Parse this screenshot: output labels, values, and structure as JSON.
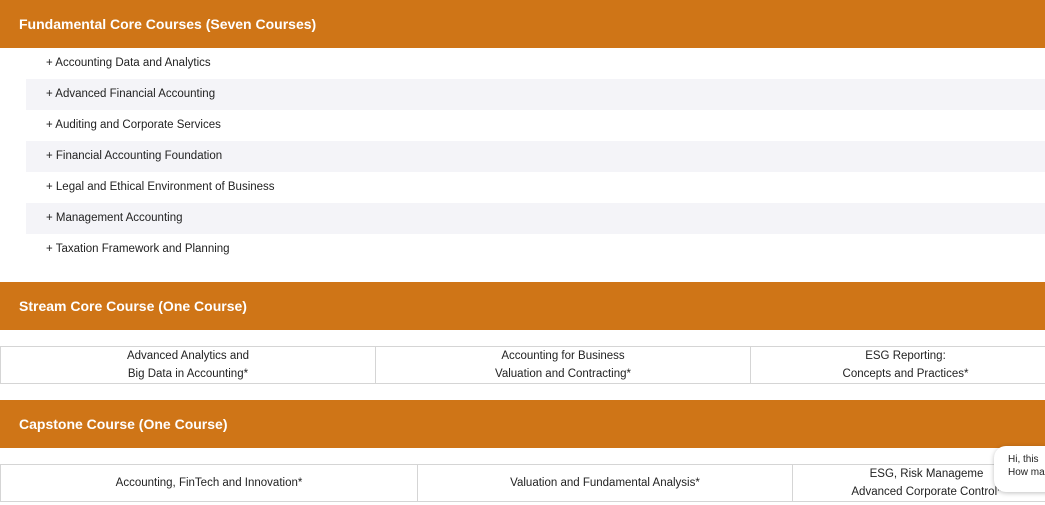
{
  "fundamental": {
    "title": "Fundamental Core Courses (Seven Courses)",
    "items": [
      "+ Accounting Data and Analytics",
      "+ Advanced Financial Accounting",
      "+ Auditing and Corporate Services",
      "+ Financial Accounting Foundation",
      "+ Legal and Ethical Environment of Business",
      "+ Management Accounting",
      "+ Taxation Framework and Planning"
    ]
  },
  "stream": {
    "title": "Stream Core Course (One Course)",
    "cells": [
      {
        "line1": "Advanced Analytics and",
        "line2": "Big Data in Accounting*"
      },
      {
        "line1": "Accounting for Business",
        "line2": "Valuation and Contracting*"
      },
      {
        "line1": "ESG Reporting:",
        "line2": "Concepts and Practices*"
      }
    ]
  },
  "capstone": {
    "title": "Capstone Course (One Course)",
    "cells": [
      {
        "line1": "Accounting, FinTech and Innovation*"
      },
      {
        "line1": "Valuation and Fundamental Analysis*"
      },
      {
        "line1": "ESG, Risk Manageme",
        "line2": "Advanced Corporate Control*"
      }
    ]
  },
  "chat": {
    "line1": "Hi, this",
    "line2": "How ma"
  },
  "colors": {
    "accent": "#cf7517",
    "stripe": "#f4f4f8",
    "border": "#d5d5d5"
  }
}
